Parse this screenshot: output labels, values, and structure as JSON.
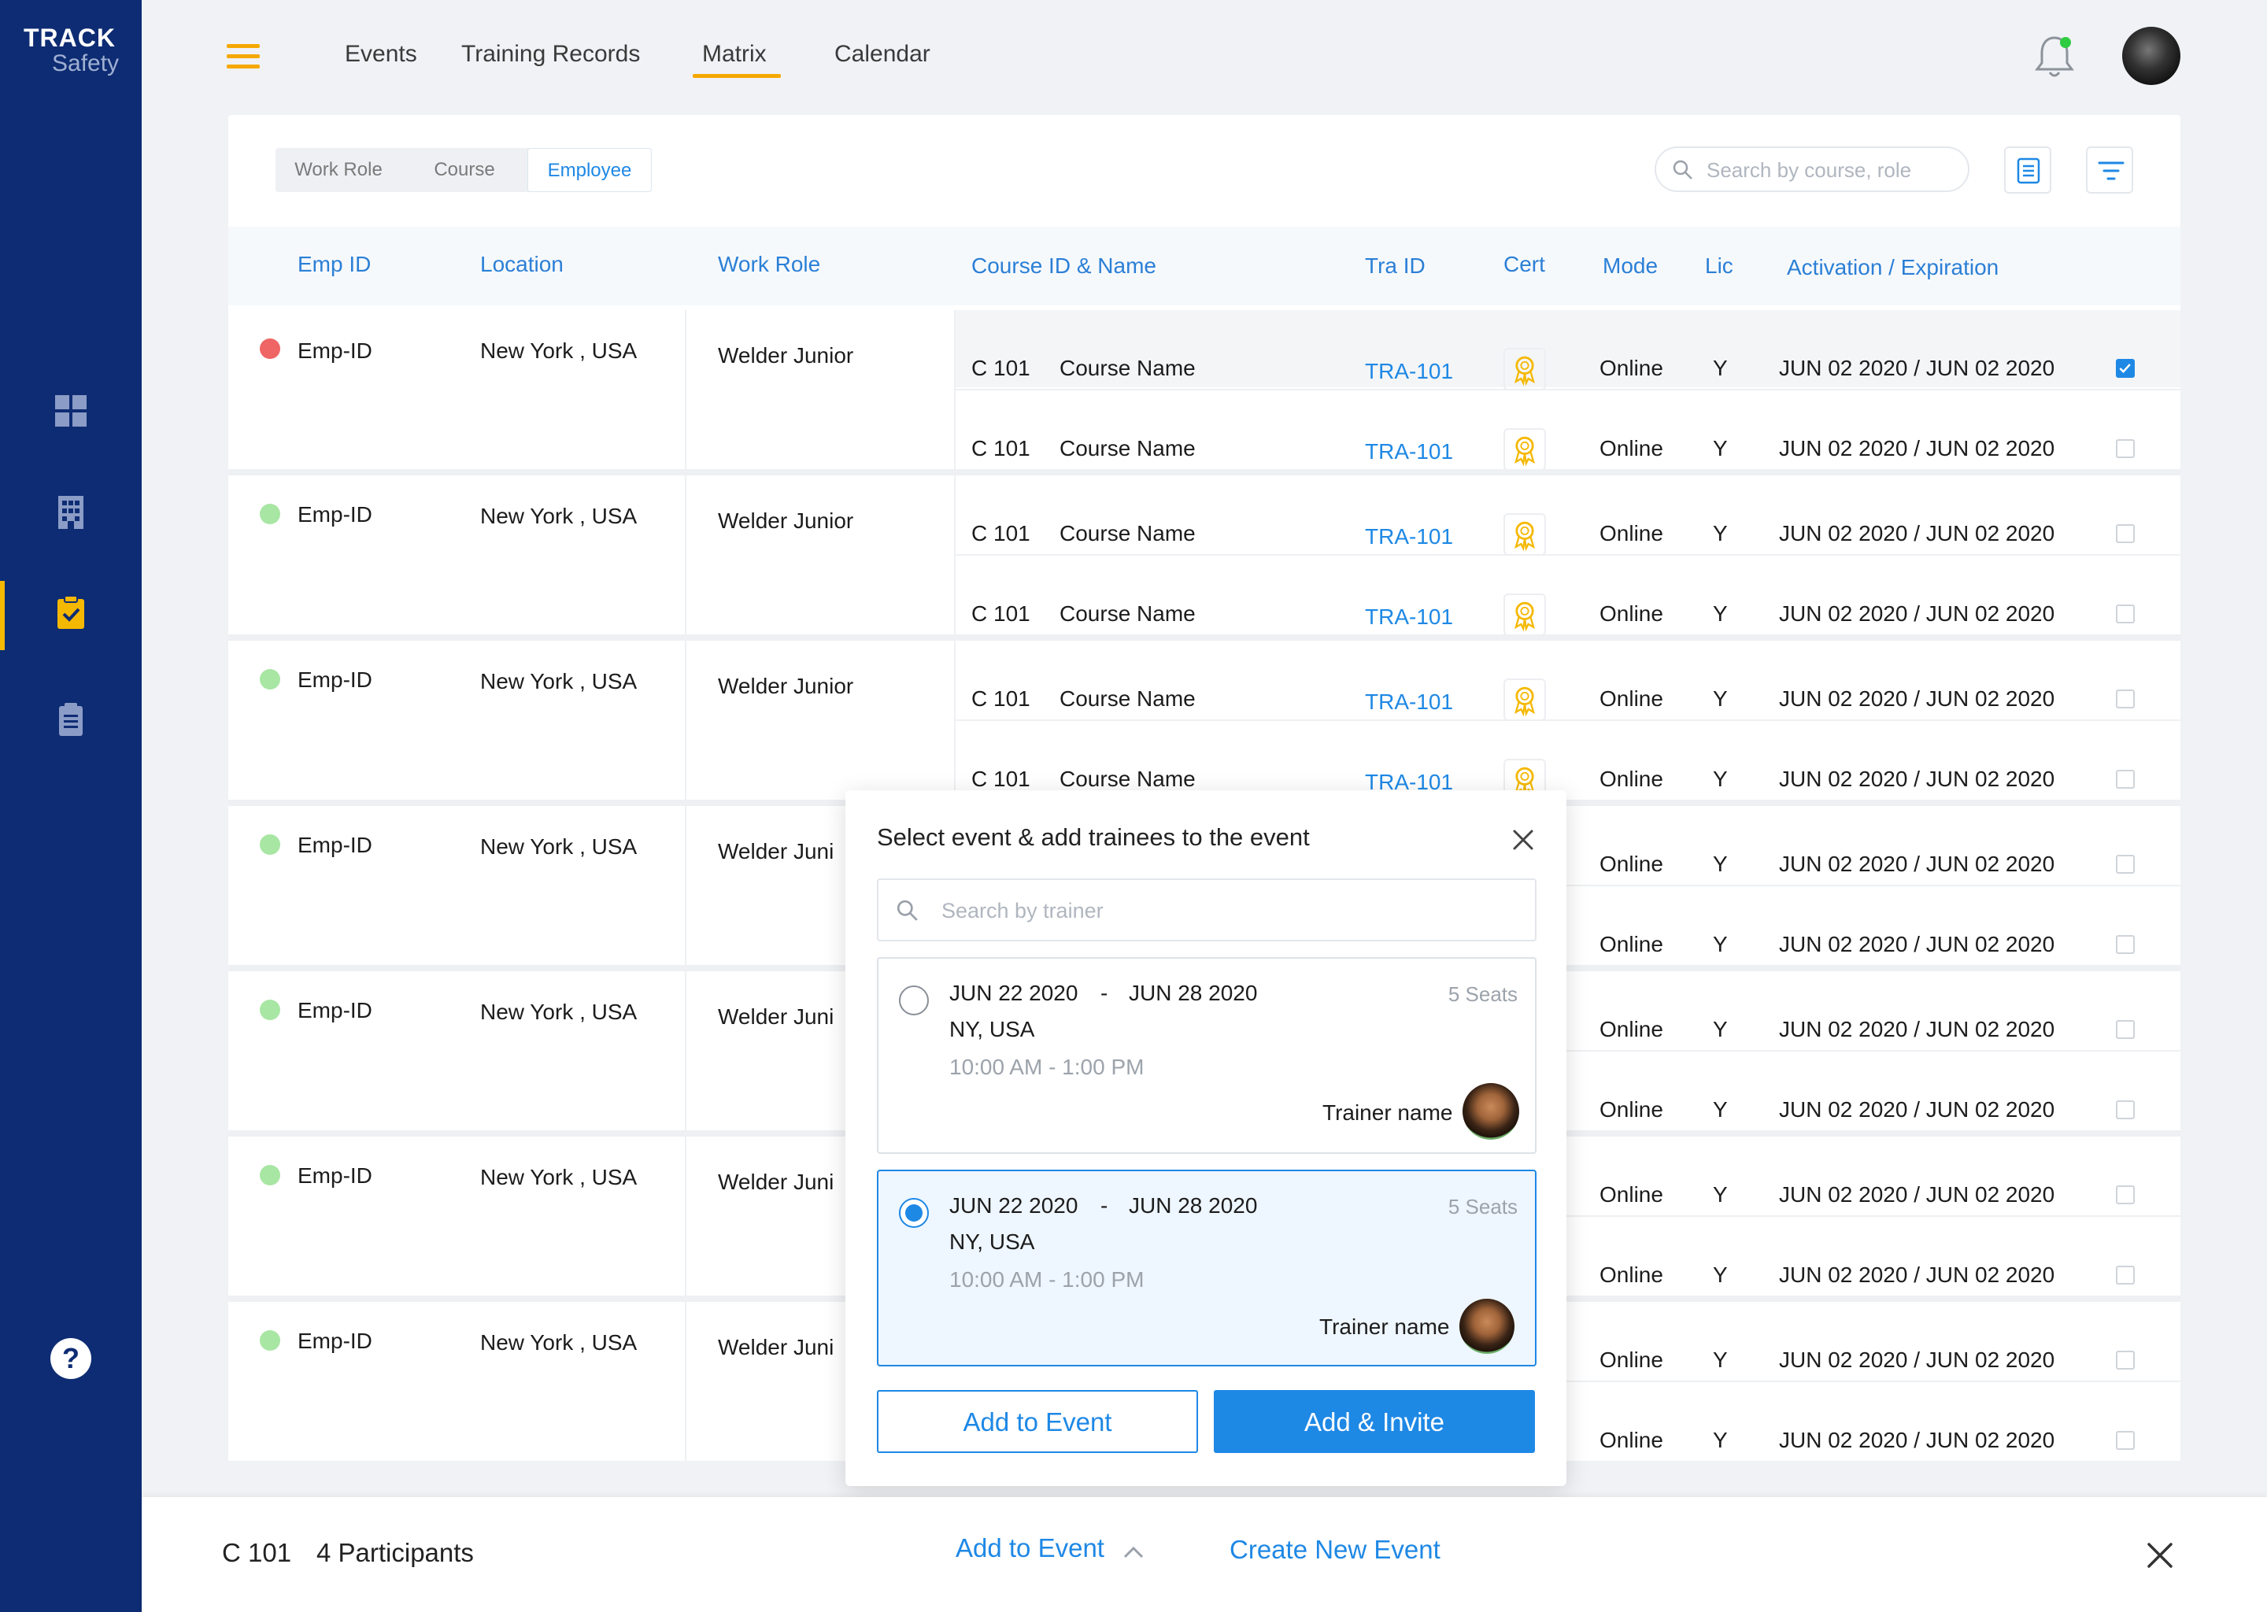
{
  "sidebar": {
    "logo_line1": "TRACK",
    "logo_line2": "Safety",
    "icons": [
      "dashboard-icon",
      "building-icon",
      "clipboard-check-icon",
      "document-icon"
    ],
    "active_index": 2,
    "help_label": "?",
    "colors": {
      "background": "#0e2c73",
      "accent": "#f5b800"
    }
  },
  "topnav": {
    "items": [
      "Events",
      "Training Records",
      "Matrix",
      "Calendar"
    ],
    "active": "Matrix",
    "notification_dot_color": "#2ecc40"
  },
  "toolbar": {
    "segments": [
      "Work Role",
      "Course",
      "Employee"
    ],
    "active_segment": "Employee",
    "search_placeholder": "Search by course, role"
  },
  "table": {
    "headers": {
      "emp_id": "Emp ID",
      "location": "Location",
      "work_role": "Work Role",
      "course": "Course ID & Name",
      "tra_id": "Tra ID",
      "cert": "Cert",
      "mode": "Mode",
      "lic": "Lic",
      "activation": "Activation / Expiration"
    },
    "employees": [
      {
        "status": "red",
        "emp_id": "Emp-ID",
        "location": "New York , USA",
        "work_role": "Welder Junior",
        "courses": [
          {
            "course_id": "C 101",
            "course_name": "Course Name",
            "tra_id": "TRA-101",
            "mode": "Online",
            "lic": "Y",
            "activation": "JUN 02 2020 / JUN 02 2020",
            "checked": true,
            "highlight": true
          },
          {
            "course_id": "C 101",
            "course_name": "Course Name",
            "tra_id": "TRA-101",
            "mode": "Online",
            "lic": "Y",
            "activation": "JUN 02 2020 / JUN 02 2020",
            "checked": false
          }
        ]
      },
      {
        "status": "green",
        "emp_id": "Emp-ID",
        "location": "New York , USA",
        "work_role": "Welder Junior",
        "courses": [
          {
            "course_id": "C 101",
            "course_name": "Course Name",
            "tra_id": "TRA-101",
            "mode": "Online",
            "lic": "Y",
            "activation": "JUN 02 2020 / JUN 02 2020",
            "checked": false
          },
          {
            "course_id": "C 101",
            "course_name": "Course Name",
            "tra_id": "TRA-101",
            "mode": "Online",
            "lic": "Y",
            "activation": "JUN 02 2020 / JUN 02 2020",
            "checked": false
          }
        ]
      },
      {
        "status": "green",
        "emp_id": "Emp-ID",
        "location": "New York , USA",
        "work_role": "Welder Junior",
        "courses": [
          {
            "course_id": "C 101",
            "course_name": "Course Name",
            "tra_id": "TRA-101",
            "mode": "Online",
            "lic": "Y",
            "activation": "JUN 02 2020 / JUN 02 2020",
            "checked": false
          },
          {
            "course_id": "C 101",
            "course_name": "Course Name",
            "tra_id": "TRA-101",
            "mode": "Online",
            "lic": "Y",
            "activation": "JUN 02 2020 / JUN 02 2020",
            "checked": false
          }
        ]
      },
      {
        "status": "green",
        "emp_id": "Emp-ID",
        "location": "New York , USA",
        "work_role": "Welder Juni",
        "courses": [
          {
            "mode": "Online",
            "lic": "Y",
            "activation": "JUN 02 2020 / JUN 02 2020",
            "checked": false
          },
          {
            "mode": "Online",
            "lic": "Y",
            "activation": "JUN 02 2020 / JUN 02 2020",
            "checked": false
          }
        ]
      },
      {
        "status": "green",
        "emp_id": "Emp-ID",
        "location": "New York , USA",
        "work_role": "Welder Juni",
        "courses": [
          {
            "mode": "Online",
            "lic": "Y",
            "activation": "JUN 02 2020 / JUN 02 2020",
            "checked": false
          },
          {
            "mode": "Online",
            "lic": "Y",
            "activation": "JUN 02 2020 / JUN 02 2020",
            "checked": false
          }
        ]
      },
      {
        "status": "green",
        "emp_id": "Emp-ID",
        "location": "New York , USA",
        "work_role": "Welder Juni",
        "courses": [
          {
            "mode": "Online",
            "lic": "Y",
            "activation": "JUN 02 2020 / JUN 02 2020",
            "checked": false
          },
          {
            "mode": "Online",
            "lic": "Y",
            "activation": "JUN 02 2020 / JUN 02 2020",
            "checked": false
          }
        ]
      },
      {
        "status": "green",
        "emp_id": "Emp-ID",
        "location": "New York , USA",
        "work_role": "Welder Juni",
        "courses": [
          {
            "mode": "Online",
            "lic": "Y",
            "activation": "JUN 02 2020 / JUN 02 2020",
            "checked": false
          },
          {
            "mode": "Online",
            "lic": "Y",
            "activation": "JUN 02 2020 / JUN 02 2020",
            "checked": false
          }
        ]
      }
    ],
    "status_colors": {
      "red": "#ef6464",
      "green": "#a8e6a3"
    }
  },
  "modal": {
    "title": "Select event & add trainees to the event",
    "search_placeholder": "Search by trainer",
    "events": [
      {
        "start": "JUN 22 2020",
        "separator": "-",
        "end": "JUN 28 2020",
        "seats": "5 Seats",
        "location": "NY, USA",
        "time": "10:00 AM - 1:00 PM",
        "trainer": "Trainer name",
        "selected": false
      },
      {
        "start": "JUN 22 2020",
        "separator": "-",
        "end": "JUN 28 2020",
        "seats": "5 Seats",
        "location": "NY, USA",
        "time": "10:00 AM - 1:00 PM",
        "trainer": "Trainer name",
        "selected": true
      }
    ],
    "buttons": {
      "add_to_event": "Add to Event",
      "add_invite": "Add & Invite"
    }
  },
  "bottombar": {
    "course_id": "C 101",
    "participants": "4 Participants",
    "add_to_event": "Add to Event",
    "create_new_event": "Create New Event"
  },
  "colors": {
    "primary": "#1e88e5",
    "accent": "#f5a800"
  }
}
